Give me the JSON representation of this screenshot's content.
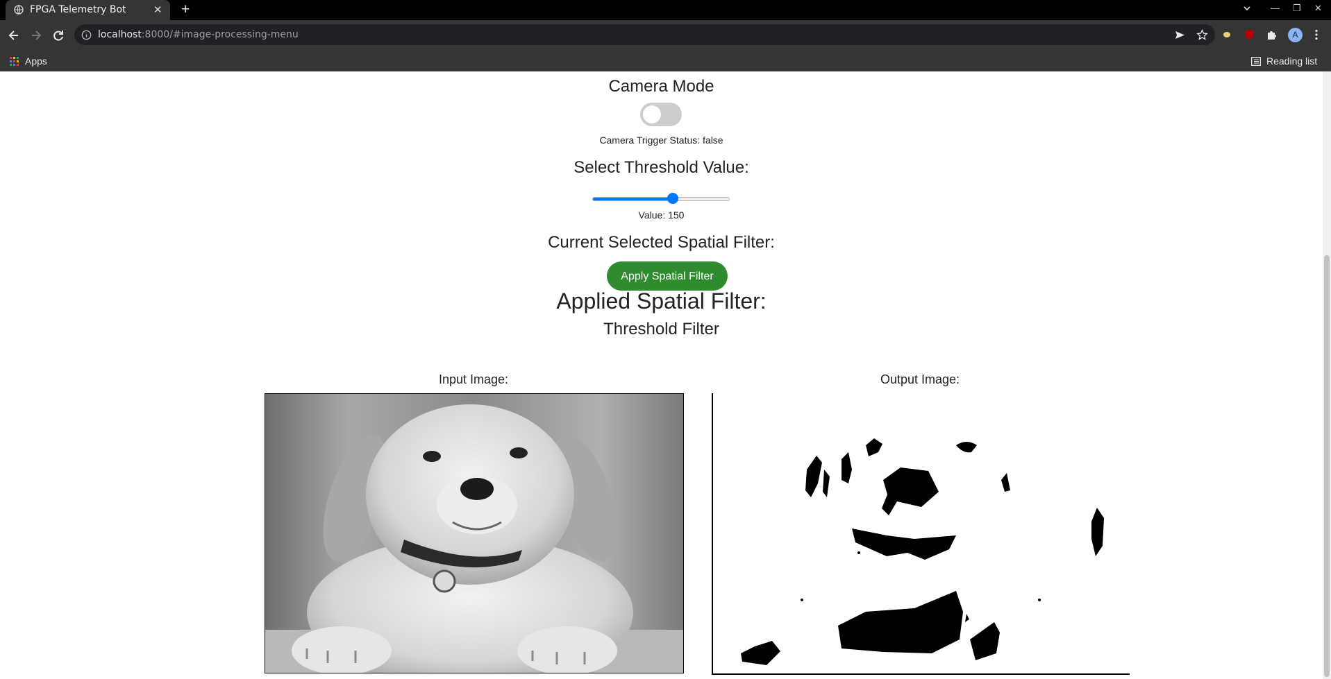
{
  "browser": {
    "tab_title": "FPGA Telemetry Bot",
    "tab_close": "✕",
    "new_tab": "+",
    "url_host": "localhost",
    "url_path": ":8000/#image-processing-menu",
    "bookmarks_apps": "Apps",
    "reading_list": "Reading list",
    "avatar_letter": "A",
    "window_controls": {
      "minimize": "—",
      "restore": "❐",
      "close": "✕"
    }
  },
  "camera": {
    "heading": "Camera Mode",
    "toggle_on": false,
    "status_text": "Camera Trigger Status: false"
  },
  "threshold": {
    "heading": "Select Threshold Value:",
    "value": 150,
    "min": 0,
    "max": 255,
    "value_label": "Value: 150",
    "accent": "#0075ff"
  },
  "spatial_filter": {
    "current_heading": "Current Selected Spatial Filter:",
    "apply_button": "Apply Spatial Filter",
    "button_color": "#2e8b2e",
    "applied_heading": "Applied Spatial Filter:",
    "applied_name": "Threshold Filter"
  },
  "images": {
    "input_label": "Input Image:",
    "output_label": "Output Image:"
  },
  "icons": [
    "globe-icon",
    "back-arrow-icon",
    "forward-arrow-icon",
    "reload-icon",
    "info-icon",
    "send-icon",
    "star-icon",
    "extension-icon",
    "puzzle-icon",
    "apps-grid-icon",
    "reading-list-icon"
  ]
}
